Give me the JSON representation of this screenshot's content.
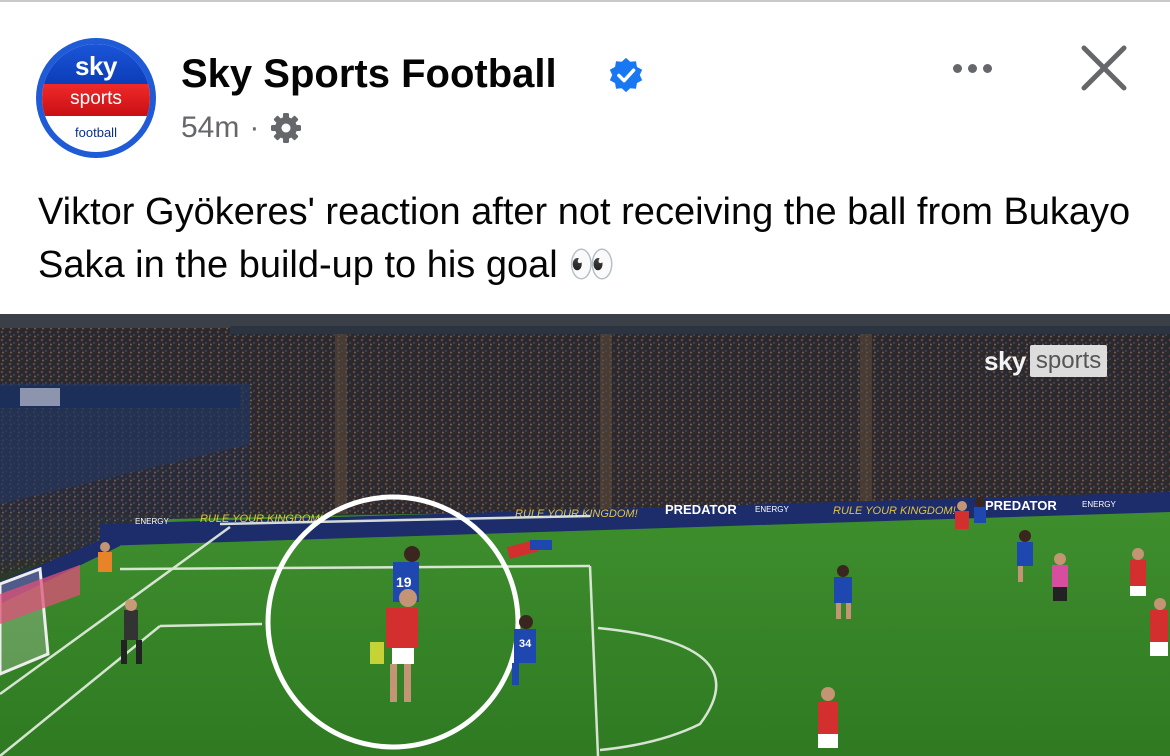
{
  "post": {
    "page_name": "Sky Sports Football",
    "time": "54m",
    "separator": "·",
    "caption": "Viktor Gyökeres' reaction after not receiving the ball from Bukayo Saka in the build-up to his goal 👀",
    "privacy_icon": "gear-icon",
    "verified_icon": "verified-badge-icon"
  },
  "avatar": {
    "sky": "sky",
    "sports": "sports",
    "football": "football"
  },
  "actions": {
    "more_icon": "ellipsis-icon",
    "close_icon": "close-icon"
  },
  "video": {
    "watermark_sky": "sky",
    "watermark_sports": "sports",
    "boards": [
      "PREDATOR",
      "ENERGY",
      "RULE YOUR KINGDOM!"
    ],
    "shirt_numbers": [
      "19",
      "34"
    ]
  },
  "colors": {
    "verified_blue": "#1877f2",
    "secondary_text": "#65676b",
    "sky_blue": "#1a55d8",
    "sky_red": "#e0191f"
  }
}
